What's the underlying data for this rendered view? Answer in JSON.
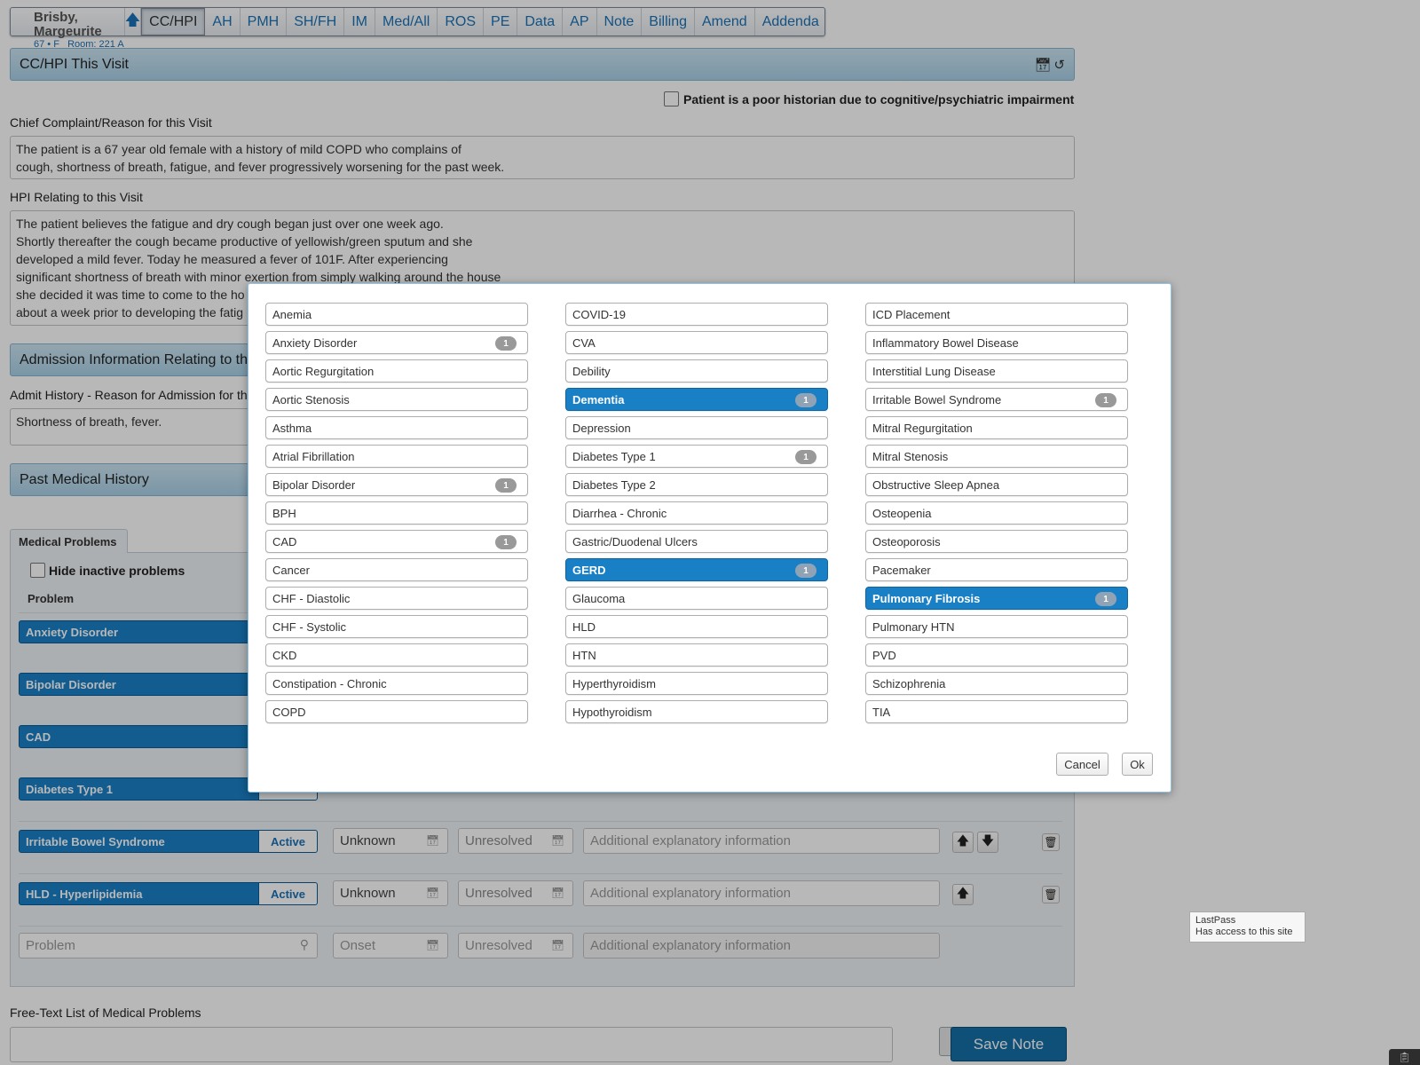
{
  "patient": {
    "name": "Brisby, Margeurite",
    "details": "67 • F   Room: 221 A"
  },
  "nav": {
    "up_icon": "arrow-up-icon",
    "tabs": [
      "CC/HPI",
      "AH",
      "PMH",
      "SH/FH",
      "IM",
      "Med/All",
      "ROS",
      "PE",
      "Data",
      "AP",
      "Note",
      "Billing",
      "Amend",
      "Addenda"
    ],
    "active": "CC/HPI"
  },
  "cchpi": {
    "header": "CC/HPI This Visit",
    "header_icons": [
      "calendar-icon",
      "undo-icon"
    ],
    "poor_historian_label": "Patient is a poor historian due to cognitive/psychiatric impairment",
    "chief_complaint_label": "Chief Complaint/Reason for this Visit",
    "chief_complaint_lines": [
      "The patient is a 67 year old female with a history of mild COPD who complains of",
      "cough, shortness of breath, fatigue, and fever progressively worsening for the past week."
    ],
    "hpi_label": "HPI Relating to this Visit",
    "hpi_lines": [
      "The patient believes the fatigue and dry cough began just over one week ago.",
      "Shortly thereafter the cough became productive of yellowish/green sputum and she",
      "developed a mild fever. Today he measured a fever of 101F. After experiencing",
      "significant shortness of breath with minor exertion from simply walking around the house",
      "she decided it was time to come to the ho",
      "about a week prior to developing the fatig"
    ]
  },
  "admission": {
    "header": "Admission Information Relating to this",
    "admit_label": "Admit History - Reason for Admission for th",
    "admit_text": "Shortness of breath, fever."
  },
  "pmh": {
    "header": "Past Medical History",
    "tab_label": "Medical Problems",
    "hide_inactive_label": "Hide inactive problems",
    "col_problem": "Problem",
    "rows": [
      {
        "name": "Anxiety Disorder"
      },
      {
        "name": "Bipolar Disorder"
      },
      {
        "name": "CAD"
      },
      {
        "name": "Diabetes Type 1"
      },
      {
        "name": "Irritable Bowel Syndrome",
        "status": "Active",
        "onset": "Unknown",
        "resolved": "Unresolved",
        "info_placeholder": "Additional explanatory information"
      },
      {
        "name": "HLD - Hyperlipidemia",
        "status": "Active",
        "onset": "Unknown",
        "resolved": "Unresolved",
        "info_placeholder": "Additional explanatory information"
      }
    ],
    "new_row": {
      "problem_placeholder": "Problem",
      "onset_placeholder": "Onset",
      "resolved_placeholder": "Unresolved",
      "info_placeholder": "Additional explanatory information"
    },
    "free_text_label": "Free-Text List of Medical Problems",
    "save_label": "Save Note"
  },
  "modal": {
    "columns": [
      [
        {
          "label": "Anemia"
        },
        {
          "label": "Anxiety Disorder",
          "badge": "1"
        },
        {
          "label": "Aortic Regurgitation"
        },
        {
          "label": "Aortic Stenosis"
        },
        {
          "label": "Asthma"
        },
        {
          "label": "Atrial Fibrillation"
        },
        {
          "label": "Bipolar Disorder",
          "badge": "1"
        },
        {
          "label": "BPH"
        },
        {
          "label": "CAD",
          "badge": "1"
        },
        {
          "label": "Cancer"
        },
        {
          "label": "CHF - Diastolic"
        },
        {
          "label": "CHF - Systolic"
        },
        {
          "label": "CKD"
        },
        {
          "label": "Constipation - Chronic"
        },
        {
          "label": "COPD"
        }
      ],
      [
        {
          "label": "COVID-19"
        },
        {
          "label": "CVA"
        },
        {
          "label": "Debility"
        },
        {
          "label": "Dementia",
          "badge": "1",
          "selected": true
        },
        {
          "label": "Depression"
        },
        {
          "label": "Diabetes Type 1",
          "badge": "1"
        },
        {
          "label": "Diabetes Type 2"
        },
        {
          "label": "Diarrhea - Chronic"
        },
        {
          "label": "Gastric/Duodenal Ulcers"
        },
        {
          "label": "GERD",
          "badge": "1",
          "selected": true
        },
        {
          "label": "Glaucoma"
        },
        {
          "label": "HLD"
        },
        {
          "label": "HTN"
        },
        {
          "label": "Hyperthyroidism"
        },
        {
          "label": "Hypothyroidism"
        }
      ],
      [
        {
          "label": "ICD Placement"
        },
        {
          "label": "Inflammatory Bowel Disease"
        },
        {
          "label": "Interstitial Lung Disease"
        },
        {
          "label": "Irritable Bowel Syndrome",
          "badge": "1"
        },
        {
          "label": "Mitral Regurgitation"
        },
        {
          "label": "Mitral Stenosis"
        },
        {
          "label": "Obstructive Sleep Apnea"
        },
        {
          "label": "Osteopenia"
        },
        {
          "label": "Osteoporosis"
        },
        {
          "label": "Pacemaker"
        },
        {
          "label": "Pulmonary Fibrosis",
          "badge": "1",
          "selected": true
        },
        {
          "label": "Pulmonary HTN"
        },
        {
          "label": "PVD"
        },
        {
          "label": "Schizophrenia"
        },
        {
          "label": "TIA"
        }
      ]
    ],
    "cancel_label": "Cancel",
    "ok_label": "Ok"
  },
  "tooltip": {
    "title": "LastPass",
    "text": "Has access to this site"
  },
  "colors": {
    "accent": "#1a80c6",
    "header": "#a9d1e8",
    "link": "#1a72b8"
  }
}
